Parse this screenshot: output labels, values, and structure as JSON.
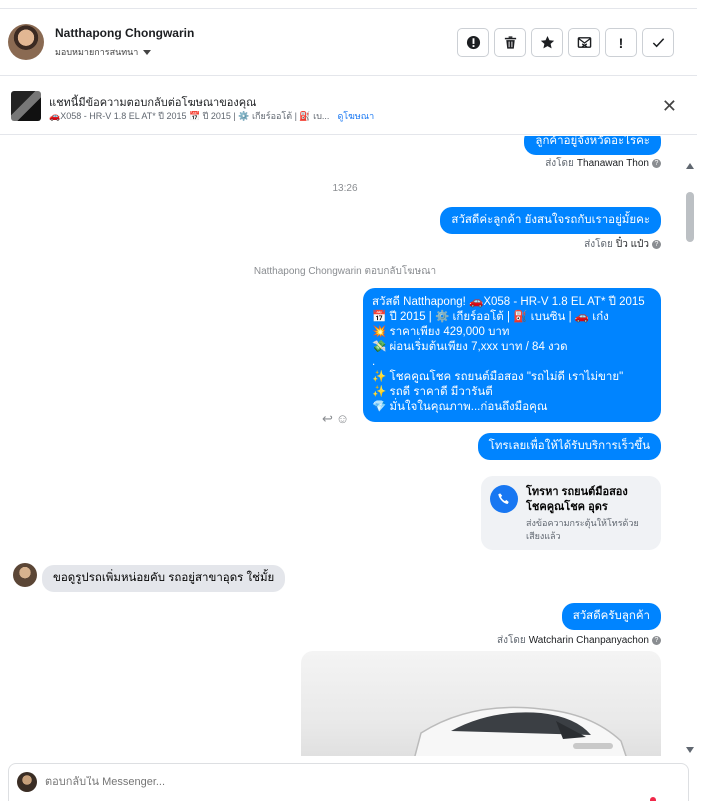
{
  "header": {
    "name": "Natthapong Chongwarin",
    "assign_label": "มอบหมายการสนทนา",
    "actions": [
      {
        "icon": "exclamation-circle-icon"
      },
      {
        "icon": "trash-icon"
      },
      {
        "icon": "star-icon"
      },
      {
        "icon": "mail-x-icon"
      },
      {
        "icon": "exclamation-icon",
        "glyph": "!"
      },
      {
        "icon": "check-icon"
      }
    ]
  },
  "ad_banner": {
    "title": "แชทนี้มีข้อความตอบกลับต่อโฆษณาของคุณ",
    "description": "🚗X058 - HR-V 1.8 EL AT* ปี 2015 📅 ปี 2015 | ⚙️ เกียร์ออโต้ | ⛽ เบ...",
    "link": "ดูโฆษณา"
  },
  "chat": {
    "msg1": "ลูกค้าอยู่จังหวัดอะไรคะ",
    "sent_by_1_prefix": "ส่งโดย",
    "sent_by_1_name": "Thanawan Thon",
    "time": "13:26",
    "msg2": "สวัสดีค่ะลูกค้า ยังสนใจรถกับเราอยู่มั้ยคะ",
    "sent_by_2_prefix": "ส่งโดย",
    "sent_by_2_name": "ปิ๋ว แป๋ว",
    "replied_to_ad": "Natthapong Chongwarin ตอบกลับโฆษณา",
    "ad_message_lines": [
      "สวัสดี Natthapong! 🚗X058 -  HR-V 1.8 EL AT* ปี 2015",
      "📅 ปี 2015 | ⚙️ เกียร์ออโต้ | ⛽ เบนซิน | 🚗 เก๋ง",
      "💥 ราคาเพียง 429,000 บาท",
      "💸 ผ่อนเริ่มต้นเพียง 7,xxx บาท / 84 งวด",
      ".",
      "✨ โชคคูณโชค รถยนต์มือสอง \"รถไม่ดี เราไม่ขาย\"",
      "✨ รถดี ราคาดี มีวารันตี",
      "💎 มั่นใจในคุณภาพ...ก่อนถึงมือคุณ"
    ],
    "msg3": "โทรเลยเพื่อให้ได้รับบริการเร็วขึ้น",
    "call_card": {
      "title": "โทรหา รถยนต์มือสอง โชคคูณโชค อุดร",
      "subtitle": "ส่งข้อความกระตุ้นให้โทรด้วยเสียงแล้ว"
    },
    "customer_msg": "ขอดูรูปรถเพิ่มหน่อยคับ รถอยู่สาขาอุดร ใช่มั้ย",
    "msg4": "สวัสดีครับลูกค้า",
    "sent_by_3_prefix": "ส่งโดย",
    "sent_by_3_name": "Watcharin Chanpanyachon"
  },
  "reply": {
    "placeholder": "ตอบกลับใน Messenger..."
  },
  "colors": {
    "outgoing_bubble": "#0084ff",
    "incoming_bubble": "#e4e6eb",
    "link": "#1877f2"
  }
}
